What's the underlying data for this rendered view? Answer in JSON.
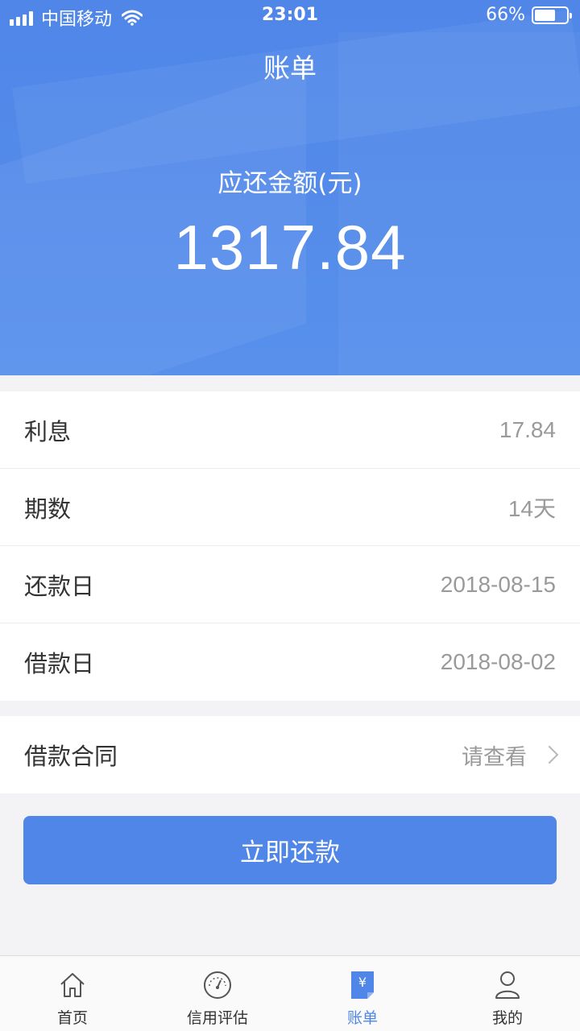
{
  "status_bar": {
    "carrier": "中国移动",
    "time": "23:01",
    "battery": "66%",
    "battery_level": 0.66
  },
  "header": {
    "title": "账单",
    "amount_label": "应还金额(元)",
    "amount_value": "1317.84"
  },
  "details": [
    {
      "label": "利息",
      "value": "17.84"
    },
    {
      "label": "期数",
      "value": "14天"
    },
    {
      "label": "还款日",
      "value": "2018-08-15"
    },
    {
      "label": "借款日",
      "value": "2018-08-02"
    }
  ],
  "contract": {
    "label": "借款合同",
    "value": "请查看"
  },
  "pay_button": "立即还款",
  "tabbar": [
    {
      "label": "首页",
      "icon": "home-icon",
      "active": false
    },
    {
      "label": "信用评估",
      "icon": "gauge-icon",
      "active": false
    },
    {
      "label": "账单",
      "icon": "bill-icon",
      "active": true
    },
    {
      "label": "我的",
      "icon": "user-icon",
      "active": false
    }
  ],
  "colors": {
    "accent": "#4f86e8",
    "text": "#333333",
    "muted": "#9a9a9a"
  }
}
